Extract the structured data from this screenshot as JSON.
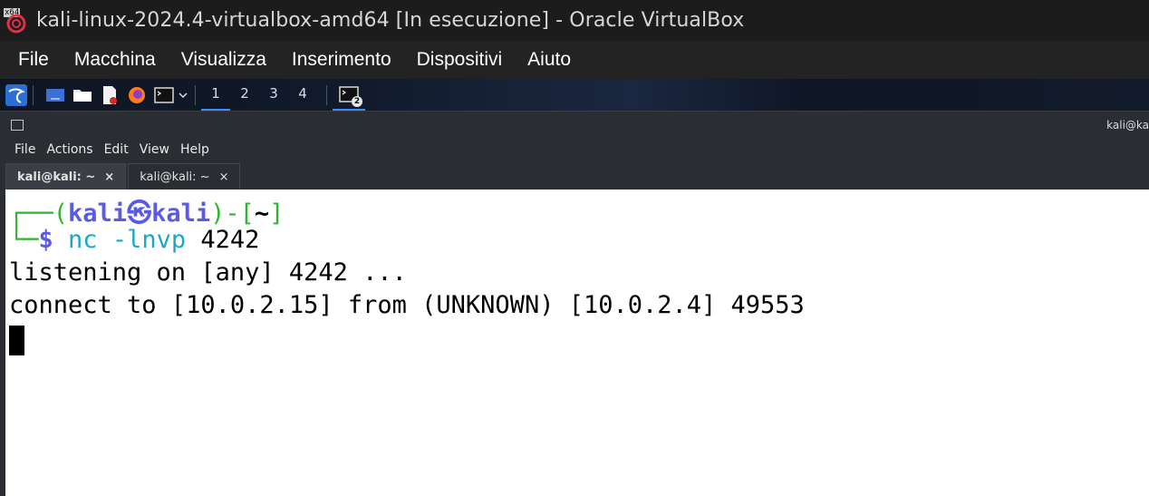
{
  "window": {
    "badge": "x64",
    "title": "kali-linux-2024.4-virtualbox-amd64 [In esecuzione] - Oracle VirtualBox"
  },
  "host_menu": [
    "File",
    "Macchina",
    "Visualizza",
    "Inserimento",
    "Dispositivi",
    "Aiuto"
  ],
  "panel": {
    "workspaces": [
      "1",
      "2",
      "3",
      "4"
    ],
    "active_workspace": "1",
    "terminal_task_count": "2",
    "accent": "#3d8bff"
  },
  "terminal": {
    "title": "kali@ka",
    "menu": [
      "File",
      "Actions",
      "Edit",
      "View",
      "Help"
    ],
    "tabs": [
      {
        "label": "kali@kali: ~",
        "close": "×",
        "active": true
      },
      {
        "label": "kali@kali: ~",
        "close": "×",
        "active": false
      }
    ],
    "prompt": {
      "corner_top": "┌──(",
      "user": "kali",
      "at": "㉿",
      "host": "kali",
      "mid": ")-[",
      "dir": "~",
      "end": "]",
      "corner_bottom": "└─",
      "dollar": "$",
      "cmd": "nc",
      "args": " -lnvp",
      "port": " 4242"
    },
    "output": [
      "listening on [any] 4242 ...",
      "connect to [10.0.2.15] from (UNKNOWN) [10.0.2.4] 49553"
    ]
  }
}
